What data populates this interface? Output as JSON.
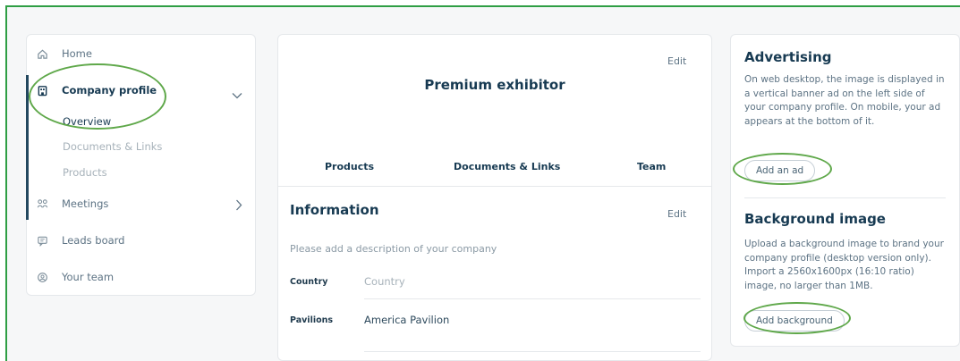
{
  "sidebar": {
    "items": [
      {
        "label": "Home",
        "icon": "home-icon"
      },
      {
        "label": "Company profile",
        "icon": "building-icon"
      },
      {
        "label": "Meetings",
        "icon": "meetings-icon"
      },
      {
        "label": "Leads board",
        "icon": "chat-icon"
      },
      {
        "label": "Your team",
        "icon": "team-icon"
      }
    ],
    "subitems": [
      {
        "label": "Overview"
      },
      {
        "label": "Documents & Links"
      },
      {
        "label": "Products"
      }
    ]
  },
  "header": {
    "edit_label": "Edit",
    "badge": "Premium exhibitor"
  },
  "tabs": [
    "Products",
    "Documents & Links",
    "Team"
  ],
  "information": {
    "title": "Information",
    "edit_label": "Edit",
    "description_placeholder": "Please add a description of your company",
    "fields": [
      {
        "label": "Country",
        "value": "Country"
      },
      {
        "label": "Pavilions",
        "value": "America Pavilion"
      }
    ]
  },
  "advertising": {
    "title": "Advertising",
    "text": "On web desktop, the image is displayed in a vertical banner ad on the left side of your company profile. On mobile, your ad appears at the bottom of it.",
    "button": "Add an ad"
  },
  "background": {
    "title": "Background image",
    "text": "Upload a background image to brand your company profile (desktop version only). Import a 2560x1600px (16:10 ratio) image, no larger than 1MB.",
    "button": "Add background"
  },
  "colors": {
    "accent": "#173a52",
    "annotation": "#5fa84a",
    "frame": "#2e9e44"
  }
}
